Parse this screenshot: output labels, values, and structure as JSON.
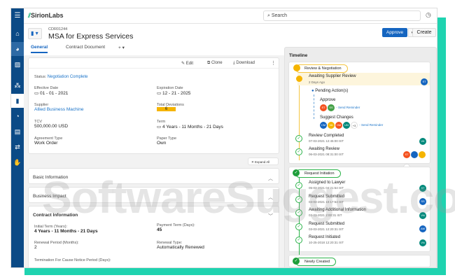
{
  "app": {
    "brand_prefix": "Sirion",
    "brand_suffix": "Labs",
    "search_placeholder": "Search"
  },
  "header": {
    "code": "CDR01244",
    "title": "MSA for Express Services",
    "approve": "Approve",
    "create": "Create"
  },
  "tabs": [
    {
      "label": "General"
    },
    {
      "label": "Contract Document"
    },
    {
      "label": "+ ▾"
    }
  ],
  "toolbar": {
    "edit": "Edit",
    "clone": "Clone",
    "download": "Download"
  },
  "summary": {
    "status_label": "Status:",
    "status": "Negotiation Complete",
    "effective_label": "Effective Date",
    "effective": "01 - 01 - 2021",
    "expiration_label": "Expiration Date",
    "expiration": "12 - 21 - 2025",
    "supplier_label": "Supplier",
    "supplier": "Allied Business Machine",
    "deviations_label": "Total Deviations",
    "deviations": "6",
    "tcv_label": "TCV",
    "tcv": "500,000.00 USD",
    "term_label": "Term",
    "term": "4 Years - 11 Months - 21 Days",
    "agreement_label": "Agreement Type",
    "agreement": "Work Order",
    "paper_label": "Paper Type",
    "paper": "Own"
  },
  "expand_all": "Expand All",
  "sections": [
    "Basic Information",
    "Business Impact",
    "Contract Information"
  ],
  "contract_info": {
    "initial_term_label": "Initial Term (Years):",
    "initial_term": "4 Years - 11 Months - 21 Days",
    "payment_term_label": "Payment Term (Days):",
    "payment_term": "45",
    "renewal_period_label": "Renewal Period (Months):",
    "renewal_period": "2",
    "renewal_type_label": "Renewal Type:",
    "renewal_type": "Automatically Renewed",
    "termination_label": "Termination For Cause Notice Period (Days):"
  },
  "timeline": {
    "title": "Timeline",
    "stage1": "Review & Negotiation",
    "current": {
      "title": "Awaiting Supplier Review",
      "sub": "2 Days Ago",
      "avatar": "ST"
    },
    "pending": "Pending Action(s)",
    "approve": "Approve",
    "approve_avatars": [
      "ST",
      "SS"
    ],
    "send_reminder": "- Send Reminder",
    "suggest": "Suggest Changes",
    "suggest_avatars": [
      "CM",
      "VA",
      "OM",
      "UN"
    ],
    "more3": "+3",
    "stage1_items": [
      {
        "title": "Review Completed",
        "sub": "07-03-2021  12:45:00 IST",
        "av": "VK"
      },
      {
        "title": "Awaiting Review",
        "sub": "06-03-2021  08:31:00 IST",
        "av": "ST",
        "more": "+1"
      }
    ],
    "stage2": "Request Initiation",
    "stage2_items": [
      {
        "title": "Assigned to Lawyer",
        "sub": "05-03-2021  04:21:54 IST",
        "av": "ST"
      },
      {
        "title": "Request Submitted",
        "sub": "04-03-2021  10:17:54 IST",
        "av": "SS"
      },
      {
        "title": "Awaiting Additional Information",
        "sub": "03-03-2021  2:00:31 IST",
        "av": "VN"
      },
      {
        "title": "Request Submitted",
        "sub": "03-03-2021  12:20:31 IST",
        "av": "AM"
      },
      {
        "title": "Request Initiated",
        "sub": "10-25-2018  12:20:31 IST",
        "av": "VN"
      }
    ],
    "stage3": "Newly Created"
  },
  "watermark": "SoftwareSuggest.com",
  "colors": {
    "brand": "#0b4a86",
    "accent": "#1565c0",
    "teal": "#1fd3b0",
    "warning": "#f5b400",
    "success": "#2cb34a"
  }
}
